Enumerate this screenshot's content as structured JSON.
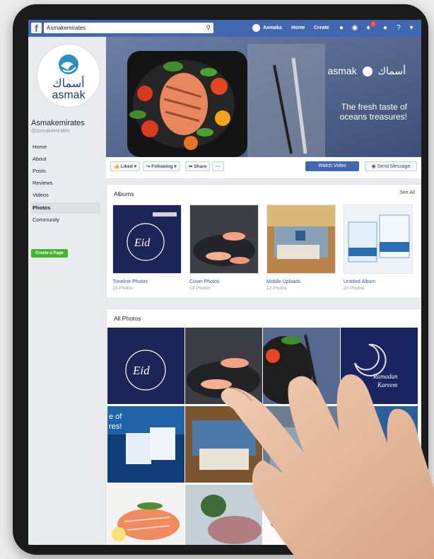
{
  "topbar": {
    "search_value": "Asmakemirates",
    "user_name": "Asmaka",
    "home": "Home",
    "create": "Create",
    "notification_count": "1",
    "icons": [
      "friends-icon",
      "messenger-icon",
      "notifications-icon",
      "friend-requests-icon",
      "help-icon",
      "chevron-down-icon"
    ]
  },
  "page": {
    "name": "Asmakemirates",
    "handle": "@asmakemirates",
    "logo_arabic": "أسماك",
    "logo_latin": "asmak"
  },
  "sidebar": {
    "items": [
      {
        "label": "Home"
      },
      {
        "label": "About"
      },
      {
        "label": "Posts"
      },
      {
        "label": "Reviews"
      },
      {
        "label": "Videos"
      },
      {
        "label": "Photos"
      },
      {
        "label": "Community"
      }
    ],
    "create_page": "Create a Page"
  },
  "cover": {
    "brand_latin": "asmak",
    "brand_arabic": "أسماك",
    "tagline_line1": "The fresh taste of",
    "tagline_line2": "oceans treasures!"
  },
  "actions": {
    "liked": "Liked",
    "following": "Following",
    "share": "Share",
    "more": "···",
    "watch_video": "Watch Video",
    "send_message": "Send Message"
  },
  "albums": {
    "title": "Albums",
    "see_all": "See All",
    "items": [
      {
        "name": "Timeline Photos",
        "count": "23 Photos"
      },
      {
        "name": "Cover Photos",
        "count": "13 Photos"
      },
      {
        "name": "Mobile Uploads",
        "count": "12 Photos"
      },
      {
        "name": "Untitled Album",
        "count": "20 Photos"
      }
    ]
  },
  "photos": {
    "title": "All Photos"
  },
  "colors": {
    "brand_blue": "#4267b2",
    "link_blue": "#385898",
    "green": "#42b72a",
    "background": "#e9ebee"
  }
}
